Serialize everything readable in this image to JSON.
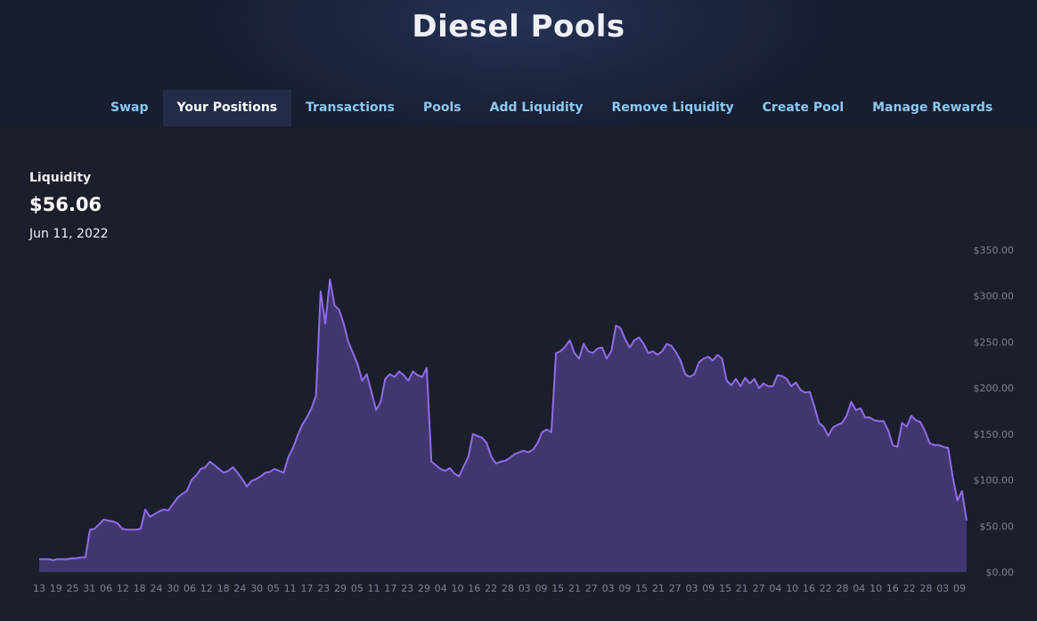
{
  "header": {
    "title": "Diesel Pools"
  },
  "nav": {
    "items": [
      {
        "label": "Swap",
        "active": false
      },
      {
        "label": "Your Positions",
        "active": true
      },
      {
        "label": "Transactions",
        "active": false
      },
      {
        "label": "Pools",
        "active": false
      },
      {
        "label": "Add Liquidity",
        "active": false
      },
      {
        "label": "Remove Liquidity",
        "active": false
      },
      {
        "label": "Create Pool",
        "active": false
      },
      {
        "label": "Manage Rewards",
        "active": false
      }
    ]
  },
  "summary": {
    "label": "Liquidity",
    "value": "$56.06",
    "date": "Jun 11, 2022"
  },
  "colors": {
    "line": "#8f6ce8",
    "fill": "#41376e",
    "accent_nav": "#8ec8f0"
  },
  "chart_data": {
    "type": "area",
    "ylim": [
      0,
      350
    ],
    "y_tick_labels": [
      "$0.00",
      "$50.00",
      "$100.00",
      "$150.00",
      "$200.00",
      "$250.00",
      "$300.00",
      "$350.00"
    ],
    "y_tick_values": [
      0,
      50,
      100,
      150,
      200,
      250,
      300,
      350
    ],
    "x_tick_labels": [
      "13",
      "19",
      "25",
      "31",
      "06",
      "12",
      "18",
      "24",
      "30",
      "06",
      "12",
      "18",
      "24",
      "30",
      "05",
      "11",
      "17",
      "23",
      "29",
      "05",
      "11",
      "17",
      "23",
      "29",
      "04",
      "10",
      "16",
      "22",
      "28",
      "03",
      "09",
      "15",
      "21",
      "27",
      "03",
      "09",
      "15",
      "21",
      "27",
      "03",
      "09",
      "15",
      "21",
      "27",
      "04",
      "10",
      "16",
      "22",
      "28",
      "04",
      "10",
      "16",
      "22",
      "28",
      "03",
      "09"
    ],
    "values": [
      14,
      14,
      14,
      13,
      14,
      14,
      14,
      15,
      15,
      16,
      16,
      46,
      47,
      52,
      57,
      56,
      55,
      53,
      47,
      46,
      46,
      46,
      47,
      68,
      60,
      63,
      66,
      68,
      67,
      74,
      81,
      85,
      88,
      100,
      105,
      112,
      114,
      120,
      116,
      112,
      108,
      110,
      114,
      108,
      101,
      93,
      99,
      101,
      104,
      108,
      109,
      112,
      110,
      108,
      125,
      135,
      148,
      160,
      168,
      178,
      192,
      305,
      270,
      318,
      290,
      285,
      270,
      250,
      238,
      226,
      208,
      215,
      196,
      176,
      185,
      210,
      215,
      212,
      218,
      214,
      208,
      218,
      214,
      212,
      222,
      120,
      116,
      112,
      110,
      113,
      107,
      104,
      115,
      125,
      150,
      148,
      146,
      140,
      125,
      118,
      120,
      121,
      124,
      128,
      130,
      132,
      130,
      133,
      140,
      152,
      155,
      152,
      238,
      240,
      245,
      252,
      238,
      232,
      248,
      240,
      238,
      243,
      244,
      232,
      240,
      268,
      265,
      253,
      244,
      252,
      255,
      248,
      238,
      240,
      236,
      240,
      248,
      246,
      239,
      230,
      215,
      212,
      215,
      228,
      232,
      234,
      230,
      236,
      232,
      208,
      203,
      210,
      202,
      211,
      205,
      210,
      200,
      205,
      202,
      202,
      214,
      213,
      210,
      202,
      206,
      198,
      195,
      196,
      180,
      162,
      158,
      148,
      157,
      160,
      162,
      170,
      185,
      176,
      178,
      168,
      168,
      165,
      164,
      164,
      154,
      138,
      136,
      162,
      158,
      170,
      165,
      163,
      153,
      140,
      138,
      138,
      136,
      135,
      103,
      78,
      88,
      56
    ]
  }
}
